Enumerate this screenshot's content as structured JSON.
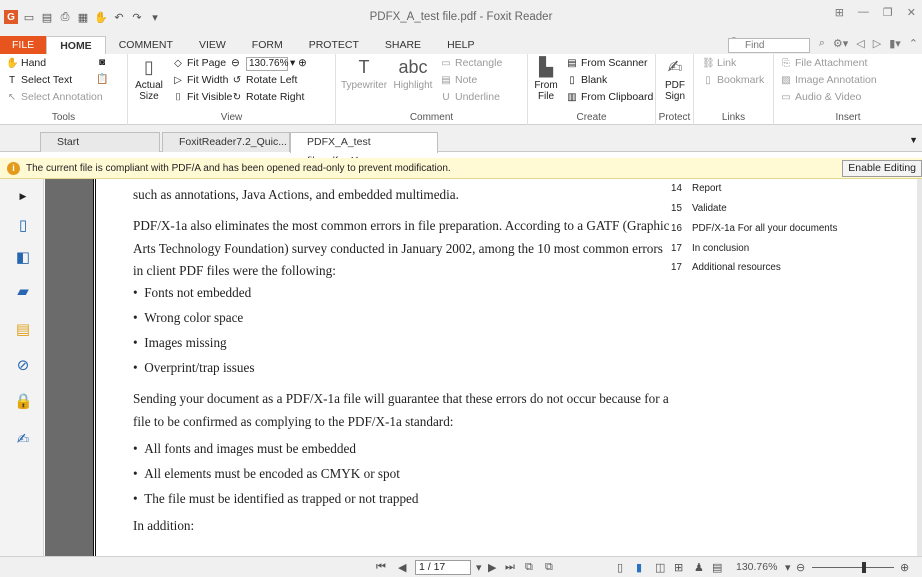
{
  "window": {
    "title": "PDFX_A_test file.pdf - Foxit Reader"
  },
  "menu": {
    "tabs": [
      "FILE",
      "HOME",
      "COMMENT",
      "VIEW",
      "FORM",
      "PROTECT",
      "SHARE",
      "HELP"
    ]
  },
  "search": {
    "placeholder": "Find"
  },
  "ribbon": {
    "tools": {
      "hand": "Hand",
      "select_text": "Select Text",
      "select_annotation": "Select Annotation",
      "label": "Tools"
    },
    "view": {
      "actual_size": "Actual Size",
      "fit_page": "Fit Page",
      "fit_width": "Fit Width",
      "fit_visible": "Fit Visible",
      "zoom_value": "130.76%",
      "rotate_left": "Rotate Left",
      "rotate_right": "Rotate Right",
      "label": "View"
    },
    "comment": {
      "typewriter": "Typewriter",
      "highlight": "Highlight",
      "rectangle": "Rectangle",
      "note": "Note",
      "underline": "Underline",
      "label": "Comment"
    },
    "create": {
      "from_file": "From File",
      "from_scanner": "From Scanner",
      "blank": "Blank",
      "from_clipboard": "From Clipboard",
      "label": "Create"
    },
    "protect": {
      "pdf_sign": "PDF Sign",
      "label": "Protect"
    },
    "links": {
      "link": "Link",
      "bookmark": "Bookmark",
      "label": "Links"
    },
    "insert": {
      "file_attachment": "File Attachment",
      "image_annotation": "Image Annotation",
      "audio_video": "Audio & Video",
      "label": "Insert"
    }
  },
  "doc_tabs": [
    "Start",
    "FoxitReader7.2_Quic...",
    "PDFX_A_test file.pdf"
  ],
  "notice": {
    "text": "The current file is compliant with PDF/A and has been opened read-only to prevent modification.",
    "button": "Enable Editing"
  },
  "document": {
    "paragraphs": [
      "such as annotations, Java Actions, and embedded multimedia.",
      "PDF/X-1a also eliminates the most common errors in file preparation. According to a GATF (Graphic Arts Technology Foundation) survey conducted in January 2002, among the 10 most common errors in client PDF files were the following:",
      "Sending your document as a PDF/X-1a file will guarantee that these errors do not occur because for a file to be confirmed as complying to the PDF/X-1a standard:",
      "In addition:"
    ],
    "bullets_a": [
      "Fonts not embedded",
      "Wrong color space",
      "Images missing",
      "Overprint/trap issues"
    ],
    "bullets_b": [
      "All fonts and images must be embedded",
      "All elements must be encoded as CMYK or spot",
      "The file must be identified as trapped or not trapped"
    ],
    "toc": [
      {
        "num": "14",
        "title": "Report"
      },
      {
        "num": "15",
        "title": "Validate"
      },
      {
        "num": "16",
        "title": "PDF/X-1a For all your documents"
      },
      {
        "num": "17",
        "title": "In conclusion"
      },
      {
        "num": "17",
        "title": "Additional resources"
      }
    ]
  },
  "status": {
    "page": "1 / 17",
    "zoom": "130.76%"
  }
}
